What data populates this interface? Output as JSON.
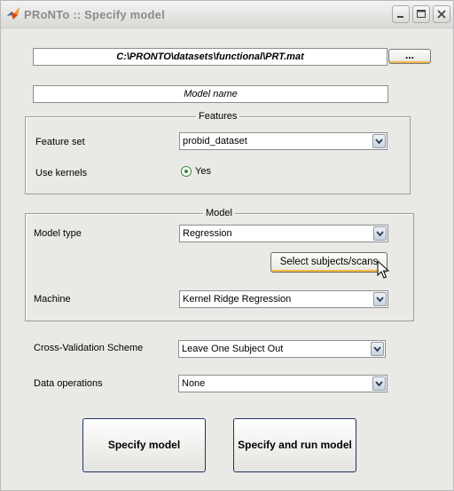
{
  "window": {
    "title": "PRoNTo :: Specify model"
  },
  "file": {
    "path_value": "C:\\PRONTO\\datasets\\functional\\PRT.mat",
    "browse_label": "..."
  },
  "model_name": {
    "placeholder": "Model name"
  },
  "features": {
    "panel_title": "Features",
    "feature_set_label": "Feature set",
    "feature_set_value": "probid_dataset",
    "use_kernels_label": "Use kernels",
    "use_kernels_option": "Yes",
    "use_kernels_checked": true
  },
  "model": {
    "panel_title": "Model",
    "model_type_label": "Model type",
    "model_type_value": "Regression",
    "select_button_label": "Select subjects/scans",
    "machine_label": "Machine",
    "machine_value": "Kernel Ridge Regression"
  },
  "cv": {
    "label": "Cross-Validation Scheme",
    "value": "Leave One Subject Out"
  },
  "data_ops": {
    "label": "Data operations",
    "value": "None"
  },
  "actions": {
    "specify_label": "Specify model",
    "run_label": "Specify and run model"
  },
  "icons": {
    "app": "matlab-membrane-icon",
    "minimize": "minimize-icon",
    "maximize": "maximize-icon",
    "close": "close-icon",
    "dropdown": "chevron-down-icon",
    "cursor": "mouse-pointer-icon"
  },
  "colors": {
    "window_bg": "#e9e9e6",
    "button_border": "#2f3b59",
    "focus_accent": "#f5b84a",
    "radio_green": "#2e8b2e"
  }
}
